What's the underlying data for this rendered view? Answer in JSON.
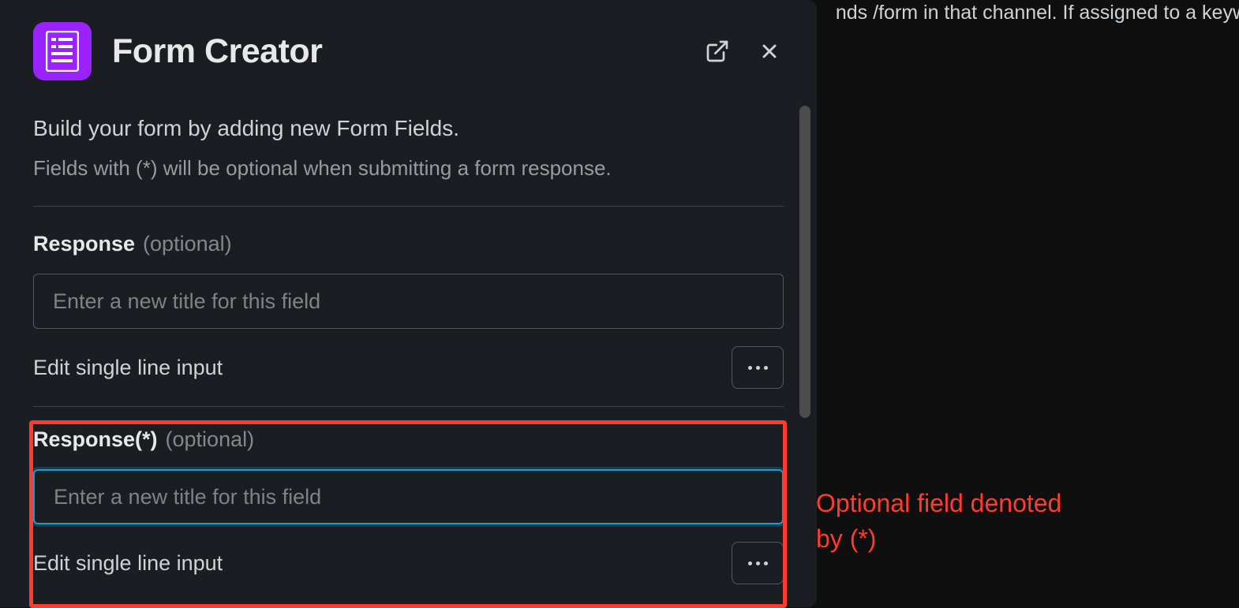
{
  "background": {
    "text": "nds /form in that channel. If assigned to a keyw"
  },
  "modal": {
    "title": "Form Creator",
    "intro": "Build your form by adding new Form Fields.",
    "subintro": "Fields with (*) will be optional when submitting a form response.",
    "fields": [
      {
        "label": "Response",
        "optional_tag": "(optional)",
        "placeholder": "Enter a new title for this field",
        "value": "",
        "edit_text": "Edit single line input",
        "focused": false
      },
      {
        "label": "Response(*)",
        "optional_tag": "(optional)",
        "placeholder": "Enter a new title for this field",
        "value": "",
        "edit_text": "Edit single line input",
        "focused": true
      }
    ]
  },
  "annotation": {
    "text_line1": "Optional field denoted",
    "text_line2": "by (*)"
  }
}
